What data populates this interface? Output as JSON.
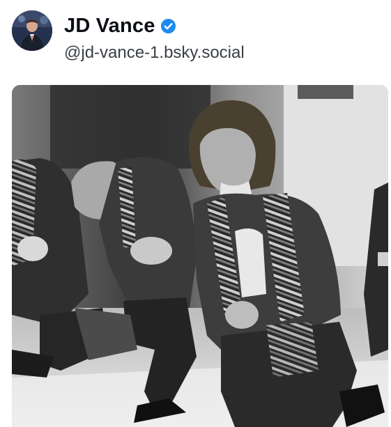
{
  "post": {
    "author": {
      "display_name": "JD Vance",
      "handle": "@jd-vance-1.bsky.social",
      "verified": true,
      "avatar_icon": "profile-photo-avatar"
    },
    "media": {
      "type": "photo",
      "style": "black-and-white",
      "icon": "embedded-photo"
    }
  },
  "colors": {
    "verified_badge": "#1d8cf0",
    "name_text": "#0b0f14",
    "handle_text": "#3a3f46"
  }
}
